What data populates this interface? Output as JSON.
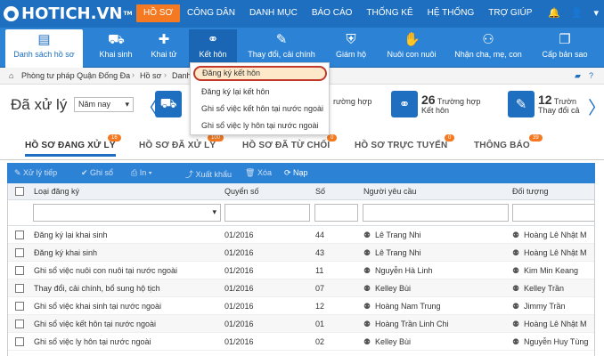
{
  "app": {
    "logo_text": "HOTICH.VN",
    "logo_tm": "TM"
  },
  "topmenu": [
    "HỒ SƠ",
    "CÔNG DÂN",
    "DANH MỤC",
    "BÁO CÁO",
    "THỐNG KÊ",
    "HỆ THỐNG",
    "TRỢ GIÚP"
  ],
  "modules": [
    "Danh sách hồ sơ",
    "Khai sinh",
    "Khai tử",
    "Kết hôn",
    "Thay đổi, cải chính",
    "Giám hộ",
    "Nuôi con nuôi",
    "Nhận cha, mẹ, con",
    "Cấp bản sao"
  ],
  "breadcrumb": [
    "Phòng tư pháp Quận Đống Đa",
    "Hồ sơ",
    "Danh"
  ],
  "dropdown": [
    "Đăng ký kết hôn",
    "Đăng ký lại kết hôn",
    "Ghi sổ việc kết hôn tại nước ngoài",
    "Ghi sổ việc ly hôn tại nước ngoài"
  ],
  "summary": {
    "title": "Đã xử lý",
    "period": "Năm nay",
    "card1_label": "rường hợp",
    "card2_num": "26",
    "card2_label1": "Trường hợp",
    "card2_label2": "Kết hôn",
    "card3_num": "12",
    "card3_label1": "Trườn",
    "card3_label2": "Thay đổi cả"
  },
  "tabs": [
    {
      "label": "HỒ SƠ ĐANG XỬ LÝ",
      "badge": "16"
    },
    {
      "label": "HỒ SƠ ĐÃ XỬ LÝ",
      "badge": "100"
    },
    {
      "label": "HỒ SƠ ĐÃ TỪ CHỐI",
      "badge": "0"
    },
    {
      "label": "HỒ SƠ TRỰC TUYẾN",
      "badge": "0"
    },
    {
      "label": "THÔNG BÁO",
      "badge": "39"
    }
  ],
  "toolbar": [
    "Xử lý tiếp",
    "Ghi sổ",
    "In",
    "Xuất khẩu",
    "Xóa",
    "Nạp"
  ],
  "grid": {
    "headers": [
      "Loại đăng ký",
      "Quyển số",
      "Số",
      "Người yêu cầu",
      "Đối tượng"
    ],
    "rows": [
      [
        "Đăng ký lại khai sinh",
        "01/2016",
        "44",
        "Lê Trang Nhi",
        "Hoàng Lê Nhật M"
      ],
      [
        "Đăng ký khai sinh",
        "01/2016",
        "43",
        "Lê Trang Nhi",
        "Hoàng Lê Nhật M"
      ],
      [
        "Ghi sổ việc nuôi con nuôi tại nước ngoài",
        "01/2016",
        "11",
        "Nguyễn Hà Linh",
        "Kim Min Keang"
      ],
      [
        "Thay đổi, cải chính, bổ sung hộ tịch",
        "01/2016",
        "07",
        "Kelley Bùi",
        "Kelley Trần"
      ],
      [
        "Ghi sổ việc khai sinh tại nước ngoài",
        "01/2016",
        "12",
        "Hoàng Nam Trung",
        "Jimmy Trần"
      ],
      [
        "Ghi sổ việc kết hôn tại nước ngoài",
        "01/2016",
        "01",
        "Hoàng Trần Linh Chi",
        "Hoàng Lê Nhật M"
      ],
      [
        "Ghi sổ việc ly hôn tại nước ngoài",
        "01/2016",
        "02",
        "Kelley Bùi",
        "Nguyễn Huy Tùng"
      ]
    ]
  }
}
